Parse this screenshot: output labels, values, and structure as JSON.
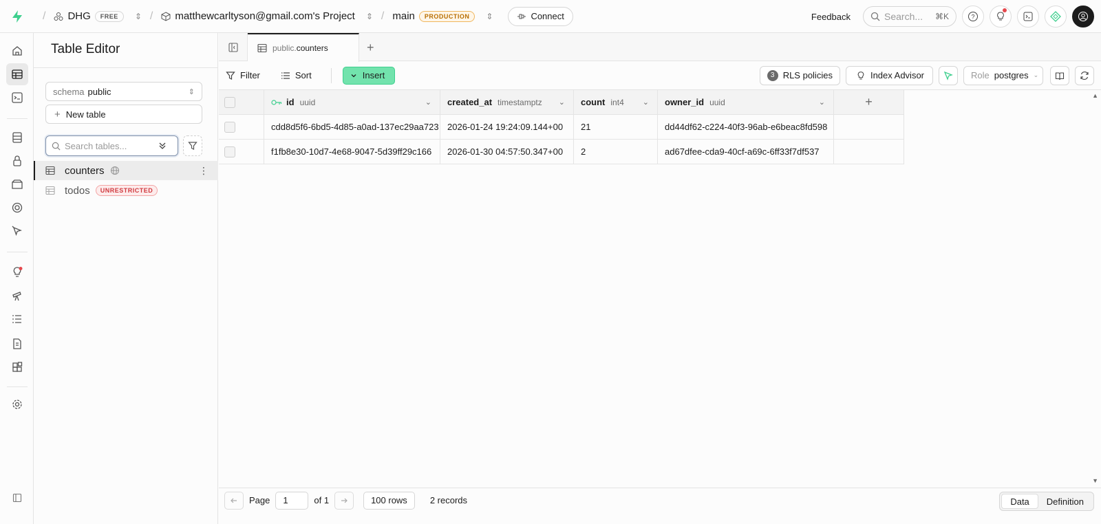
{
  "topbar": {
    "org": "DHG",
    "org_plan": "FREE",
    "project": "matthewcarltyson@gmail.com's Project",
    "branch": "main",
    "branch_env": "PRODUCTION",
    "connect_label": "Connect",
    "feedback_label": "Feedback",
    "search_placeholder": "Search...",
    "search_shortcut": "⌘K"
  },
  "sidebar": {
    "title": "Table Editor",
    "schema_label": "schema",
    "schema_value": "public",
    "new_table_label": "New table",
    "search_placeholder": "Search tables...",
    "tables": [
      {
        "name": "counters",
        "badge": ""
      },
      {
        "name": "todos",
        "badge": "UNRESTRICTED"
      }
    ]
  },
  "tab": {
    "schema": "public.",
    "name": "counters"
  },
  "toolbar": {
    "filter_label": "Filter",
    "sort_label": "Sort",
    "insert_label": "Insert",
    "rls_count": "3",
    "rls_label": "RLS policies",
    "index_label": "Index Advisor",
    "role_label": "Role",
    "role_value": "postgres"
  },
  "table": {
    "columns": [
      {
        "name": "id",
        "type": "uuid"
      },
      {
        "name": "created_at",
        "type": "timestamptz"
      },
      {
        "name": "count",
        "type": "int4"
      },
      {
        "name": "owner_id",
        "type": "uuid"
      }
    ],
    "rows": [
      [
        "cdd8d5f6-6bd5-4d85-a0ad-137ec29aa723",
        "2026-01-24 19:24:09.144+00",
        "21",
        "dd44df62-c224-40f3-96ab-e6beac8fd598"
      ],
      [
        "f1fb8e30-10d7-4e68-9047-5d39ff29c166",
        "2026-01-30 04:57:50.347+00",
        "2",
        "ad67dfee-cda9-40cf-a69c-6ff33f7df537"
      ]
    ]
  },
  "footer": {
    "page_label": "Page",
    "page_value": "1",
    "of_label": "of 1",
    "rows_label": "100 rows",
    "records_label": "2 records",
    "data_label": "Data",
    "definition_label": "Definition"
  },
  "colors": {
    "brand": "#3ecf8e",
    "insert_bg": "#72e3ad",
    "danger": "#e5484d"
  }
}
